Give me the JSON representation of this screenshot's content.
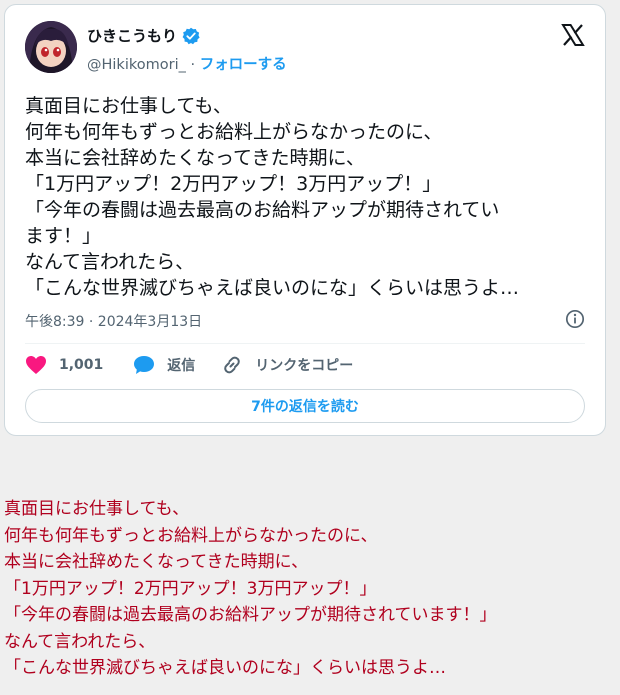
{
  "tweet": {
    "display_name": "ひきこうもり",
    "handle": "@Hikikomori_",
    "separator": " · ",
    "follow_label": "フォローする",
    "lines": [
      "真面目にお仕事しても、",
      "何年も何年もずっとお給料上がらなかったのに、",
      "本当に会社辞めたくなってきた時期に、",
      "「1万円アップ！2万円アップ！3万円アップ！」",
      "「今年の春闘は過去最高のお給料アップが期待されてい",
      "ます！」",
      "なんて言われたら、",
      "「こんな世界滅びちゃえば良いのにな」くらいは思うよ…"
    ],
    "timestamp": "午後8:39 · 2024年3月13日",
    "like_count": "1,001",
    "reply_label": "返信",
    "copy_link_label": "リンクをコピー",
    "read_replies_label": "7件の返信を読む"
  },
  "quote": {
    "lines": [
      "真面目にお仕事しても、",
      "何年も何年もずっとお給料上がらなかったのに、",
      "本当に会社辞めたくなってきた時期に、",
      "「1万円アップ！2万円アップ！3万円アップ！」",
      "「今年の春闘は過去最高のお給料アップが期待されています！」",
      "なんて言われたら、",
      "「こんな世界滅びちゃえば良いのにな」くらいは思うよ…"
    ]
  },
  "colors": {
    "accent": "#1d9bf0",
    "like": "#f91880",
    "quote_text": "#b0001e"
  },
  "icons": [
    "avatar",
    "verified-badge-icon",
    "x-logo-icon",
    "info-icon",
    "heart-icon",
    "reply-bubble-icon",
    "link-icon"
  ]
}
